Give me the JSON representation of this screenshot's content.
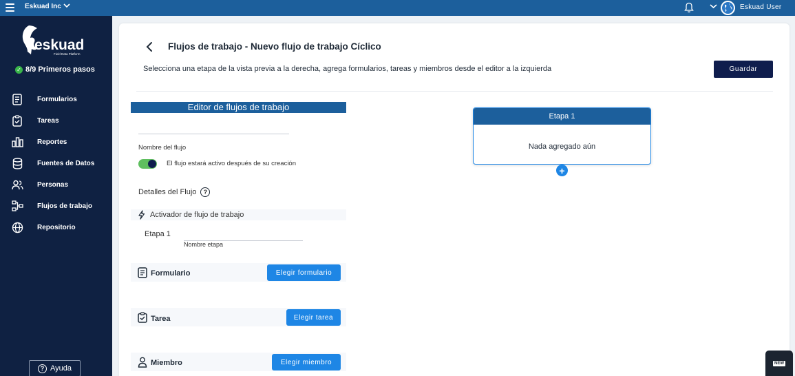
{
  "topbar": {
    "org_name": "Eskuad Inc",
    "user_name": "Eskuad User"
  },
  "sidebar": {
    "logo_text": "eskuad",
    "logo_tagline": "Field Data Platform",
    "steps": "8/9 Primeros pasos",
    "items": [
      {
        "label": "Formularios",
        "icon": "form-icon"
      },
      {
        "label": "Tareas",
        "icon": "clipboard-icon"
      },
      {
        "label": "Reportes",
        "icon": "bar-chart-icon"
      },
      {
        "label": "Fuentes de Datos",
        "icon": "database-icon"
      },
      {
        "label": "Personas",
        "icon": "people-icon"
      },
      {
        "label": "Flujos de trabajo",
        "icon": "workflow-icon"
      },
      {
        "label": "Repositorio",
        "icon": "globe-icon"
      }
    ],
    "help_label": "Ayuda"
  },
  "header": {
    "title": "Flujos de trabajo - Nuevo flujo de trabajo Cíclico",
    "subtitle": "Selecciona una etapa de la vista previa a la derecha, agrega formularios, tareas y miembros desde el editor a la izquierda",
    "save_label": "Guardar"
  },
  "editor": {
    "title": "Editor de flujos de trabajo",
    "name_value": "",
    "name_label": "Nombre del flujo",
    "toggle_text": "El flujo estará activo después de su creación",
    "details_label": "Detalles del Flujo",
    "trigger_label": "Activador de flujo de trabajo",
    "stage_label": "Etapa 1",
    "stage_name_value": "",
    "stage_name_caption": "Nombre etapa",
    "form_label": "Formulario",
    "form_button": "Elegir formulario",
    "task_label": "Tarea",
    "task_button": "Elegir tarea",
    "member_label": "Miembro",
    "member_button": "Elegir miembro"
  },
  "preview": {
    "stage_title": "Etapa 1",
    "stage_empty": "Nada agregado aún"
  },
  "badge": {
    "label": "NEW"
  },
  "colors": {
    "topbar": "#1c5f9c",
    "sidebar": "#0f2142",
    "primary_button": "#1e86e5",
    "save_button": "#0f1d4d",
    "toggle_on": "#5fbf5f"
  }
}
